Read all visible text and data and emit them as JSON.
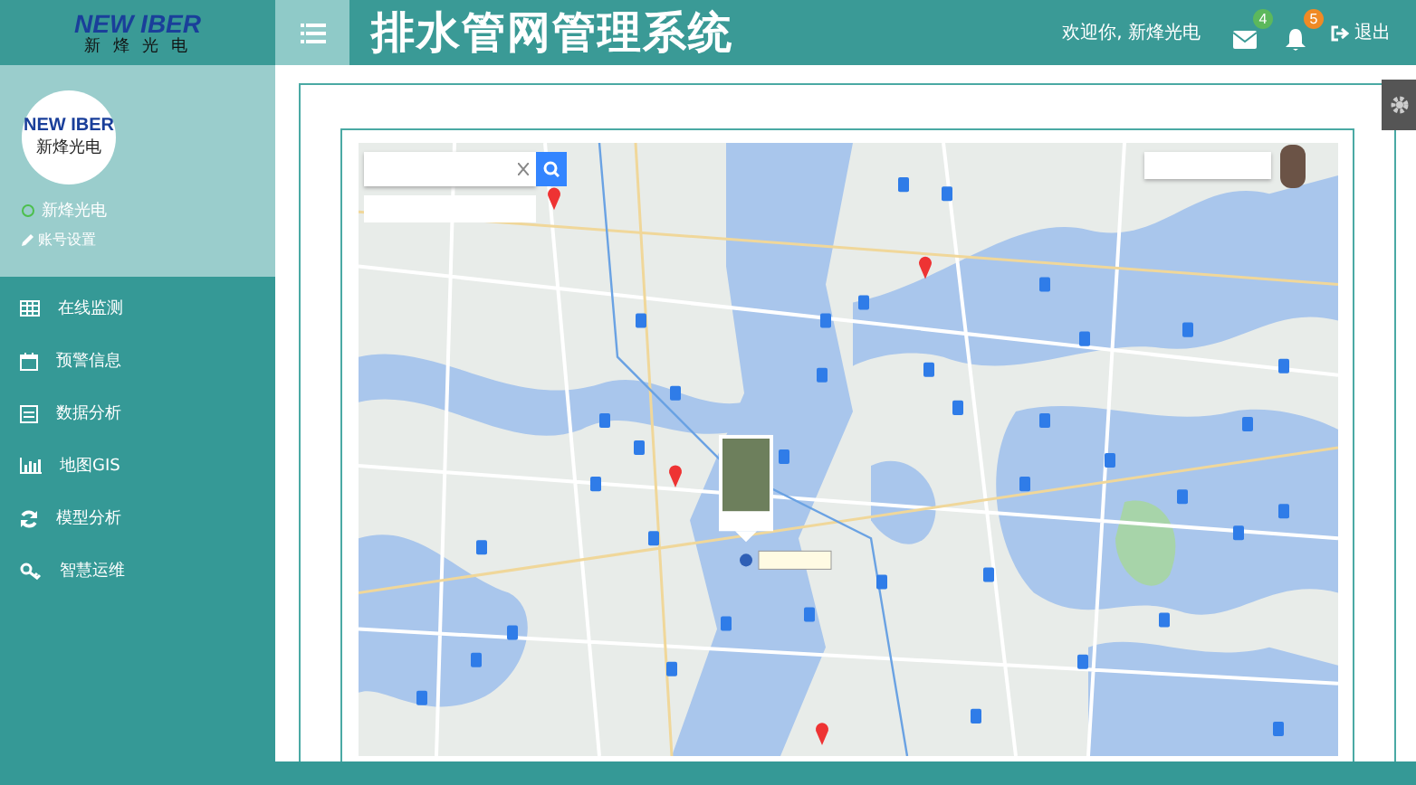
{
  "header": {
    "logo_brand": "NEW IBER",
    "logo_sub": "新 烽 光 电",
    "title": "排水管网管理系统",
    "welcome": "欢迎你, 新烽光电",
    "messages_badge": "4",
    "alerts_badge": "5",
    "logout": "退出"
  },
  "profile": {
    "avatar_brand": "NEW IBER",
    "avatar_sub": "新烽光电",
    "name": "新烽光电",
    "online": true,
    "settings": "账号设置"
  },
  "menu": [
    {
      "label": "在线监测",
      "selected": false
    },
    {
      "label": "预警信息",
      "selected": false
    },
    {
      "label": "数据分析",
      "selected": false
    },
    {
      "label": "地图GIS",
      "selected": false
    },
    {
      "label": "模型分析",
      "selected": false
    },
    {
      "label": "智慧运维",
      "selected": false
    }
  ]
}
